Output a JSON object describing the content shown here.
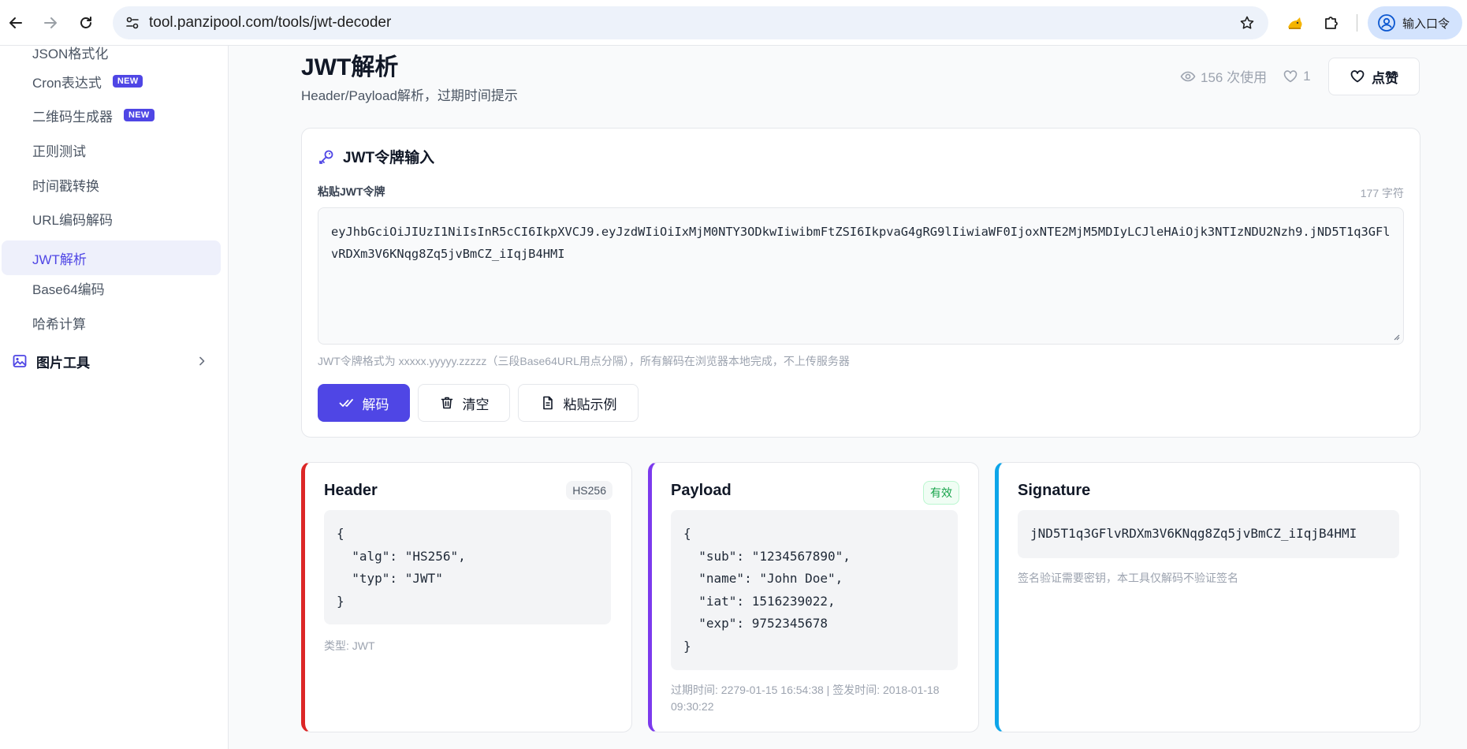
{
  "browser": {
    "url": "tool.panzipool.com/tools/jwt-decoder",
    "profile_label": "输入口令"
  },
  "sidebar": {
    "items": [
      {
        "label": "JSON格式化",
        "badge": ""
      },
      {
        "label": "Cron表达式",
        "badge": "NEW"
      },
      {
        "label": "二维码生成器",
        "badge": "NEW"
      },
      {
        "label": "正则测试",
        "badge": ""
      },
      {
        "label": "时间戳转换",
        "badge": ""
      },
      {
        "label": "URL编码解码",
        "badge": ""
      },
      {
        "label": "JWT解析",
        "badge": "",
        "active": true
      },
      {
        "label": "Base64编码",
        "badge": ""
      },
      {
        "label": "哈希计算",
        "badge": ""
      }
    ],
    "group_label": "图片工具"
  },
  "page": {
    "title": "JWT解析",
    "subtitle": "Header/Payload解析，过期时间提示",
    "views_text": "156 次使用",
    "likes_count": "1",
    "like_button_label": "点赞"
  },
  "input_card": {
    "title": "JWT令牌输入",
    "field_label": "粘贴JWT令牌",
    "char_count": "177 字符",
    "token": "eyJhbGciOiJIUzI1NiIsInR5cCI6IkpXVCJ9.eyJzdWIiOiIxMjM0NTY3ODkwIiwibmFtZSI6IkpvaG4gRG9lIiwiaWF0IjoxNTE2MjM5MDIyLCJleHAiOjk3NTIzNDU2Nzh9.jND5T1q3GFlvRDXm3V6KNqg8Zq5jvBmCZ_iIqjB4HMI",
    "hint": "JWT令牌格式为 xxxxx.yyyyy.zzzzz（三段Base64URL用点分隔），所有解码在浏览器本地完成，不上传服务器",
    "decode_label": "解码",
    "clear_label": "清空",
    "example_label": "粘贴示例"
  },
  "header_card": {
    "title": "Header",
    "badge": "HS256",
    "code": "{\n  \"alg\": \"HS256\",\n  \"typ\": \"JWT\"\n}",
    "note": "类型: JWT"
  },
  "payload_card": {
    "title": "Payload",
    "badge": "有效",
    "code": "{\n  \"sub\": \"1234567890\",\n  \"name\": \"John Doe\",\n  \"iat\": 1516239022,\n  \"exp\": 9752345678\n}",
    "note": "过期时间: 2279-01-15 16:54:38 | 签发时间: 2018-01-18 09:30:22"
  },
  "signature_card": {
    "title": "Signature",
    "value": "jND5T1q3GFlvRDXm3V6KNqg8Zq5jvBmCZ_iIqjB4HMI",
    "note": "签名验证需要密钥，本工具仅解码不验证签名"
  },
  "colors": {
    "accent": "#4f46e5",
    "header_border": "#dc2626",
    "payload_border": "#7c3aed",
    "signature_border": "#0ea5e9",
    "valid_green": "#16a34a"
  }
}
